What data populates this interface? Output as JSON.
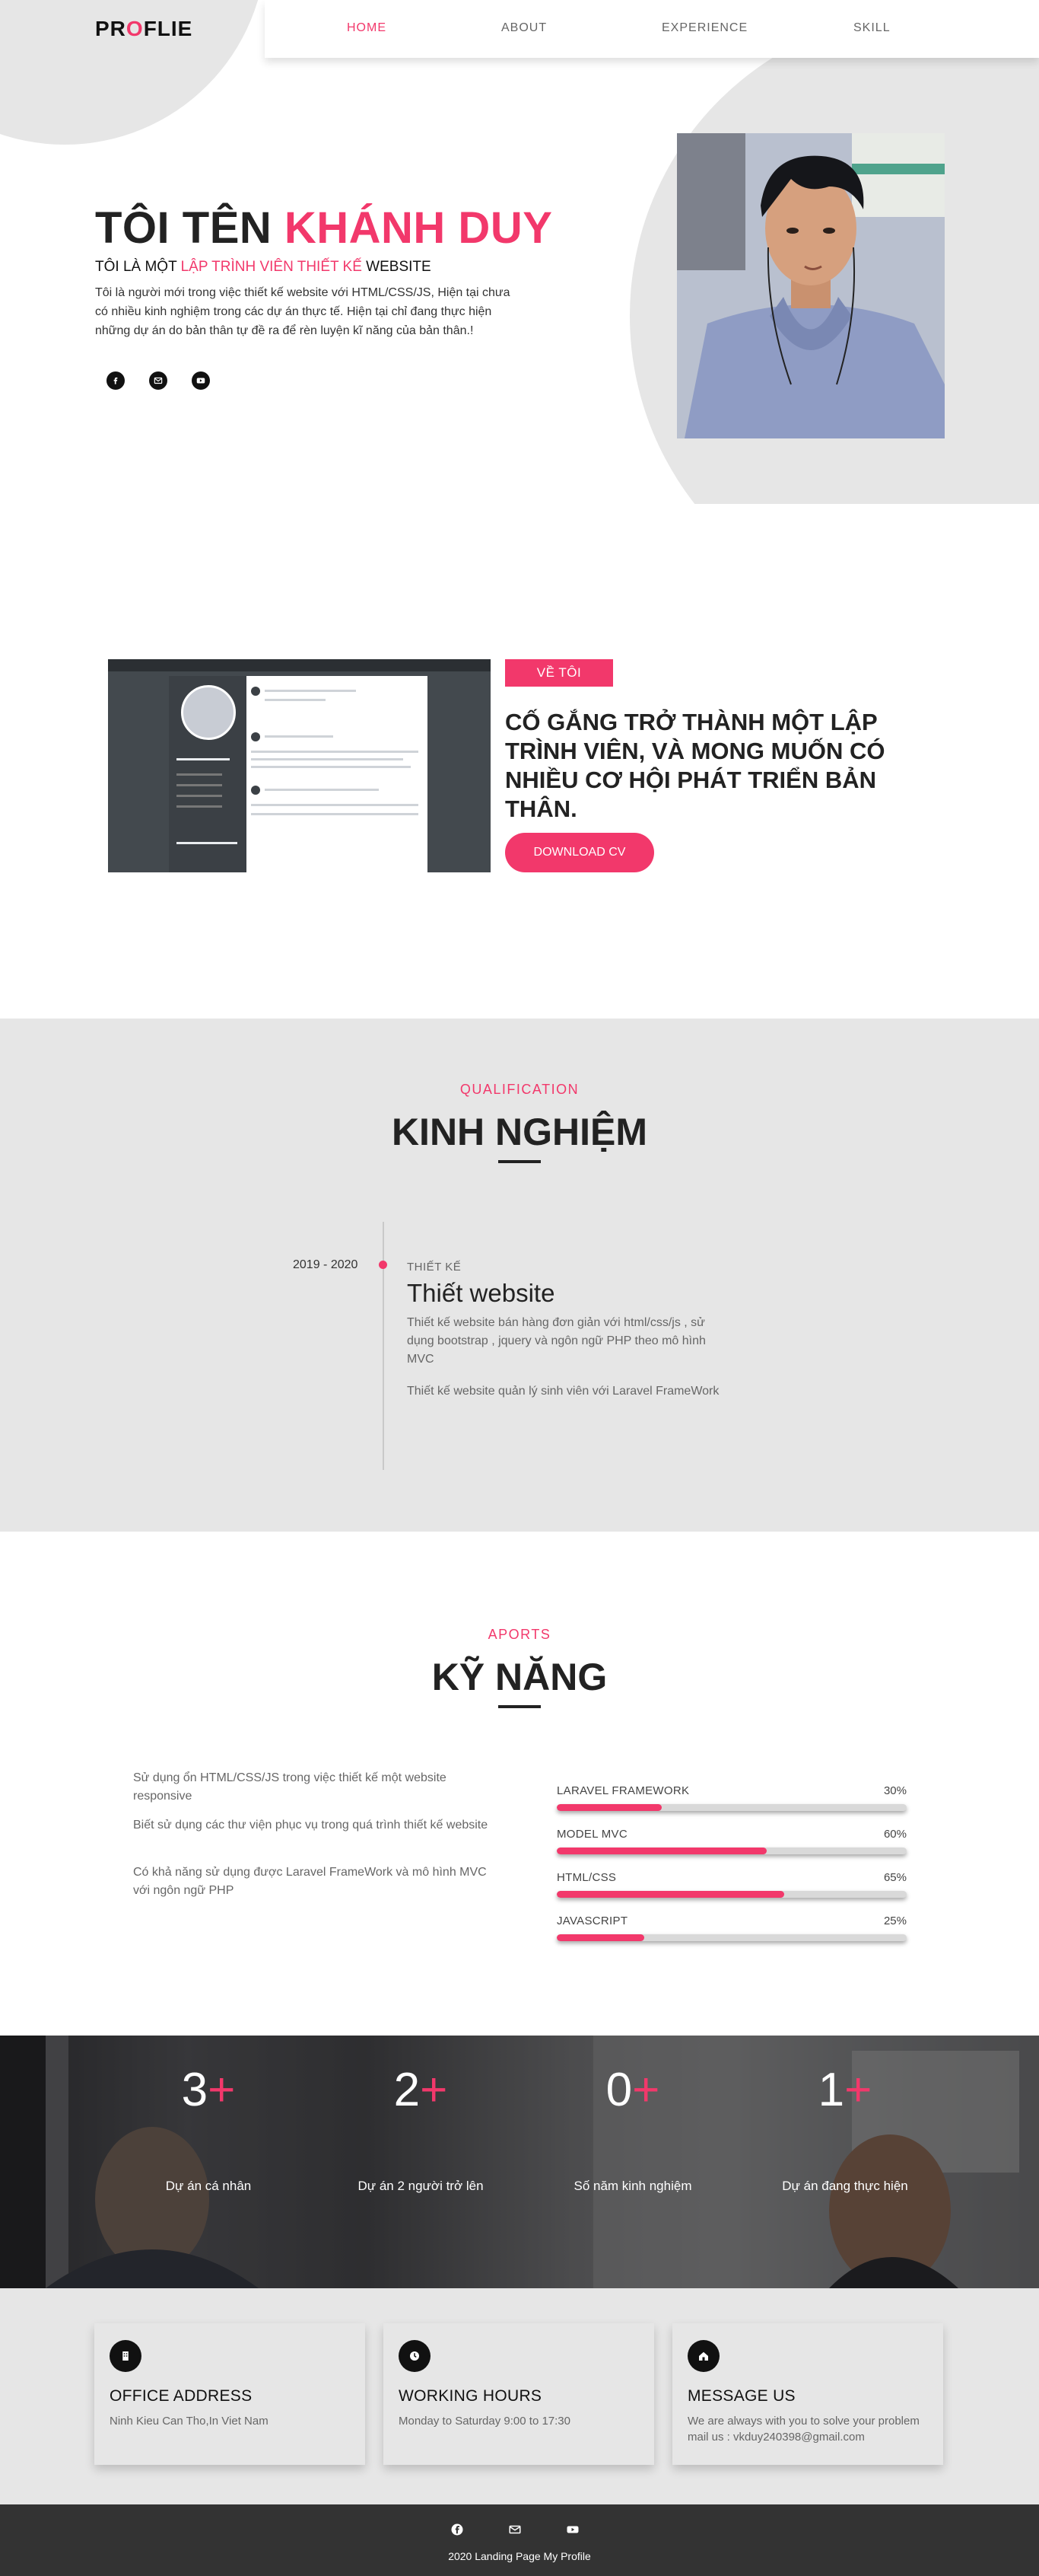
{
  "brand": {
    "logo_pre": "PR",
    "logo_o": "O",
    "logo_post": "FLIE"
  },
  "nav": {
    "items": [
      "HOME",
      "ABOUT",
      "EXPERIENCE",
      "SKILL"
    ],
    "active": "HOME"
  },
  "hero": {
    "title_pre": "TÔI TÊN ",
    "title_name": "KHÁNH DUY",
    "sub_pre": "TÔI LÀ MỘT ",
    "sub_role": "LẬP TRÌNH VIÊN THIẾT KẾ",
    "sub_post": " WEBSITE",
    "description": "Tôi là người mới trong việc thiết kế website với HTML/CSS/JS, Hiện tại chưa có nhiều kinh nghiệm trong các dự án thực tế. Hiện tại chỉ đang thực hiện những dự án do bản thân tự đề ra để rèn luyện kĩ năng của bản thân.!",
    "socials": [
      "facebook-icon",
      "mail-icon",
      "youtube-icon"
    ]
  },
  "about": {
    "badge": "VỀ TÔI",
    "heading": "CỐ GẮNG TRỞ THÀNH MỘT LẬP TRÌNH VIÊN, VÀ MONG MUỐN CÓ NHIỀU CƠ HỘI PHÁT TRIỂN BẢN THÂN.",
    "download": "DOWNLOAD CV",
    "cv": {
      "title_bar": "Vo khanh CV KHANH DUY",
      "name": "VÕ KHÁNH DUY",
      "university": "ĐẠI HỌC KỸ THUẬT CÔNG NGHỆ CẦN THƠ",
      "work": "WORK EXPERIENCE",
      "projects": "THAM GIA CÁC DỰ ÁN CỦA TRƯỜNG",
      "skills": "SKILLS"
    }
  },
  "qualification": {
    "kicker": "QUALIFICATION",
    "title": "KINH NGHIỆM",
    "item": {
      "date": "2019 - 2020",
      "kicker": "THIẾT KẾ",
      "title": "Thiết website",
      "p1": "Thiết kế website bán hàng đơn giản với html/css/js , sử dụng bootstrap , jquery và ngôn ngữ PHP theo mô hình MVC",
      "p2": "Thiết kế website quản lý sinh viên với Laravel FrameWork"
    }
  },
  "skills": {
    "kicker": "APORTS",
    "title": "KỸ NĂNG",
    "paragraphs": [
      "Sử dụng ổn HTML/CSS/JS trong việc thiết kế một website responsive",
      "Biết sử dụng các thư viện phục vụ trong quá trình thiết kế website",
      "Có khả năng sử dụng được Laravel FrameWork và mô hình MVC với ngôn ngữ PHP"
    ],
    "bars": [
      {
        "label": "LARAVEL FRAMEWORK",
        "value": "30%",
        "percent": 30
      },
      {
        "label": "MODEL MVC",
        "value": "60%",
        "percent": 60
      },
      {
        "label": "HTML/CSS",
        "value": "65%",
        "percent": 65
      },
      {
        "label": "JAVASCRIPT",
        "value": "25%",
        "percent": 25
      }
    ]
  },
  "counters": [
    {
      "num": "3",
      "plus": "+",
      "label": "Dự án cá nhân"
    },
    {
      "num": "2",
      "plus": "+",
      "label": "Dự án 2 người trở lên"
    },
    {
      "num": "0",
      "plus": "+",
      "label": "Số năm kinh nghiệm"
    },
    {
      "num": "1",
      "plus": "+",
      "label": "Dự án đang thực hiện"
    }
  ],
  "contact": [
    {
      "icon": "building-icon",
      "title": "OFFICE ADDRESS",
      "text": "Ninh Kieu Can Tho,In Viet Nam"
    },
    {
      "icon": "clock-icon",
      "title": "WORKING HOURS",
      "text": "Monday to Saturday 9:00 to 17:30"
    },
    {
      "icon": "home-icon",
      "title": "MESSAGE US",
      "text": "We are always with you to solve your problem mail us : vkduy240398@gmail.com"
    }
  ],
  "footer": {
    "socials": [
      "facebook-icon",
      "mail-icon",
      "youtube-icon"
    ],
    "text": "2020 Landing Page My Profile"
  },
  "colors": {
    "accent": "#f2386b",
    "grey": "#e6e6e6",
    "footer": "#333333"
  }
}
